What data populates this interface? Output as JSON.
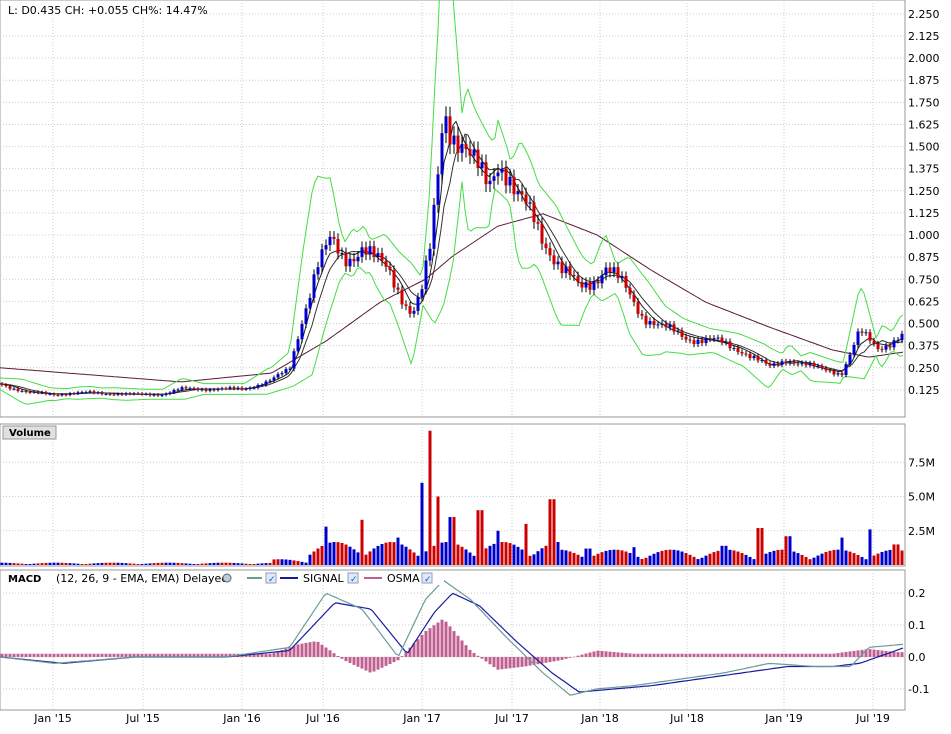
{
  "quote": {
    "text": "L: D0.435 CH: +0.055 CH%: 14.47%"
  },
  "volume_panel": {
    "label": "Volume",
    "ticks": [
      "7.5M",
      "5.0M",
      "2.5M"
    ]
  },
  "macd_panel": {
    "label": "MACD",
    "params": "(12, 26, 9 - EMA, EMA) Delayed",
    "signal_label": "SIGNAL",
    "osma_label": "OSMA",
    "ticks": [
      "0.2",
      "0.1",
      "0.0",
      "-0.1"
    ]
  },
  "x_axis": {
    "labels": [
      "Jan '15",
      "Jul '15",
      "Jan '16",
      "Jul '16",
      "Jan '17",
      "Jul '17",
      "Jan '18",
      "Jul '18",
      "Jan '19",
      "Jul '19"
    ]
  },
  "colors": {
    "up": "#0000cc",
    "down": "#cc0000",
    "bollinger": "#44dd44",
    "ma_long": "#5a1a3a",
    "macd_line": "#6a9a9a",
    "signal_line": "#1a1aa0",
    "osma": "#c06090",
    "grid": "#cccccc"
  },
  "chart_data": [
    {
      "type": "line",
      "series_label": "Price (candlestick with Bollinger Bands and moving averages)",
      "x_labels": [
        "Jan '15",
        "Jul '15",
        "Jan '16",
        "Jul '16",
        "Jan '17",
        "Jul '17",
        "Jan '18",
        "Jul '18",
        "Jan '19",
        "Jul '19"
      ],
      "y_ticks": [
        "2.250",
        "2.125",
        "2.000",
        "1.875",
        "1.750",
        "1.625",
        "1.500",
        "1.375",
        "1.250",
        "1.125",
        "1.000",
        "0.875",
        "0.750",
        "0.625",
        "0.500",
        "0.375",
        "0.250",
        "0.125"
      ],
      "ylim": [
        0,
        2.3
      ],
      "price_points": [
        [
          0,
          0.16
        ],
        [
          0.03,
          0.11
        ],
        [
          0.06,
          0.1
        ],
        [
          0.1,
          0.11
        ],
        [
          0.14,
          0.1
        ],
        [
          0.18,
          0.1
        ],
        [
          0.2,
          0.13
        ],
        [
          0.24,
          0.13
        ],
        [
          0.27,
          0.13
        ],
        [
          0.3,
          0.18
        ],
        [
          0.32,
          0.24
        ],
        [
          0.335,
          0.55
        ],
        [
          0.35,
          0.82
        ],
        [
          0.365,
          0.95
        ],
        [
          0.38,
          0.87
        ],
        [
          0.4,
          0.93
        ],
        [
          0.415,
          0.85
        ],
        [
          0.43,
          0.8
        ],
        [
          0.44,
          0.7
        ],
        [
          0.455,
          0.55
        ],
        [
          0.465,
          0.65
        ],
        [
          0.475,
          0.9
        ],
        [
          0.485,
          1.4
        ],
        [
          0.49,
          1.75
        ],
        [
          0.5,
          1.6
        ],
        [
          0.51,
          1.5
        ],
        [
          0.52,
          1.4
        ],
        [
          0.53,
          1.35
        ],
        [
          0.54,
          1.3
        ],
        [
          0.55,
          1.45
        ],
        [
          0.56,
          1.35
        ],
        [
          0.57,
          1.2
        ],
        [
          0.58,
          1.15
        ],
        [
          0.59,
          1.1
        ],
        [
          0.6,
          1.0
        ],
        [
          0.62,
          0.8
        ],
        [
          0.64,
          0.7
        ],
        [
          0.655,
          0.75
        ],
        [
          0.67,
          0.82
        ],
        [
          0.69,
          0.7
        ],
        [
          0.71,
          0.55
        ],
        [
          0.73,
          0.48
        ],
        [
          0.76,
          0.42
        ],
        [
          0.79,
          0.4
        ],
        [
          0.82,
          0.35
        ],
        [
          0.85,
          0.25
        ],
        [
          0.87,
          0.3
        ],
        [
          0.9,
          0.25
        ],
        [
          0.93,
          0.22
        ],
        [
          0.95,
          0.45
        ],
        [
          0.97,
          0.36
        ],
        [
          1.0,
          0.44
        ]
      ],
      "long_ma_points": [
        [
          0,
          0.25
        ],
        [
          0.1,
          0.21
        ],
        [
          0.2,
          0.17
        ],
        [
          0.3,
          0.22
        ],
        [
          0.36,
          0.4
        ],
        [
          0.42,
          0.62
        ],
        [
          0.47,
          0.75
        ],
        [
          0.5,
          0.88
        ],
        [
          0.55,
          1.05
        ],
        [
          0.6,
          1.12
        ],
        [
          0.66,
          1.0
        ],
        [
          0.72,
          0.8
        ],
        [
          0.78,
          0.62
        ],
        [
          0.85,
          0.48
        ],
        [
          0.92,
          0.35
        ],
        [
          0.96,
          0.31
        ],
        [
          1.0,
          0.34
        ]
      ]
    },
    {
      "type": "bar",
      "series_label": "Volume",
      "y_ticks": [
        "7.5M",
        "5.0M",
        "2.5M"
      ],
      "ylim": [
        0,
        10
      ],
      "peaks": [
        [
          0.36,
          2.8
        ],
        [
          0.4,
          3.3
        ],
        [
          0.44,
          2.0
        ],
        [
          0.465,
          6.0
        ],
        [
          0.475,
          9.8
        ],
        [
          0.485,
          5.0
        ],
        [
          0.5,
          3.5
        ],
        [
          0.53,
          4.0
        ],
        [
          0.55,
          2.5
        ],
        [
          0.58,
          3.0
        ],
        [
          0.61,
          4.8
        ],
        [
          0.65,
          1.2
        ],
        [
          0.7,
          1.3
        ],
        [
          0.8,
          1.4
        ],
        [
          0.84,
          2.7
        ],
        [
          0.87,
          2.1
        ],
        [
          0.93,
          2.0
        ],
        [
          0.96,
          2.6
        ],
        [
          0.99,
          1.5
        ]
      ]
    },
    {
      "type": "line",
      "series_label": "MACD (12, 26, 9 - EMA, EMA)",
      "y_ticks": [
        "0.2",
        "0.1",
        "0.0",
        "-0.1"
      ],
      "ylim": [
        -0.16,
        0.26
      ],
      "series": [
        {
          "name": "MACD",
          "points": [
            [
              0,
              0
            ],
            [
              0.06,
              -0.02
            ],
            [
              0.15,
              0
            ],
            [
              0.25,
              0
            ],
            [
              0.32,
              0.03
            ],
            [
              0.36,
              0.2
            ],
            [
              0.4,
              0.15
            ],
            [
              0.44,
              0.0
            ],
            [
              0.47,
              0.18
            ],
            [
              0.49,
              0.24
            ],
            [
              0.52,
              0.18
            ],
            [
              0.56,
              0.06
            ],
            [
              0.6,
              -0.05
            ],
            [
              0.63,
              -0.12
            ],
            [
              0.66,
              -0.1
            ],
            [
              0.7,
              -0.09
            ],
            [
              0.75,
              -0.07
            ],
            [
              0.8,
              -0.05
            ],
            [
              0.85,
              -0.02
            ],
            [
              0.9,
              -0.03
            ],
            [
              0.94,
              -0.03
            ],
            [
              0.96,
              0.03
            ],
            [
              1.0,
              0.04
            ]
          ]
        },
        {
          "name": "SIGNAL",
          "points": [
            [
              0,
              0
            ],
            [
              0.07,
              -0.02
            ],
            [
              0.15,
              0
            ],
            [
              0.25,
              0
            ],
            [
              0.32,
              0.02
            ],
            [
              0.37,
              0.17
            ],
            [
              0.41,
              0.15
            ],
            [
              0.45,
              0.01
            ],
            [
              0.48,
              0.14
            ],
            [
              0.5,
              0.2
            ],
            [
              0.53,
              0.16
            ],
            [
              0.57,
              0.05
            ],
            [
              0.61,
              -0.05
            ],
            [
              0.64,
              -0.11
            ],
            [
              0.68,
              -0.1
            ],
            [
              0.72,
              -0.09
            ],
            [
              0.77,
              -0.07
            ],
            [
              0.82,
              -0.05
            ],
            [
              0.87,
              -0.03
            ],
            [
              0.92,
              -0.03
            ],
            [
              0.95,
              -0.02
            ],
            [
              1.0,
              0.03
            ]
          ]
        },
        {
          "name": "OSMA",
          "bars": [
            [
              0.3,
              0.01
            ],
            [
              0.33,
              0.04
            ],
            [
              0.35,
              0.05
            ],
            [
              0.38,
              -0.01
            ],
            [
              0.41,
              -0.05
            ],
            [
              0.44,
              -0.01
            ],
            [
              0.47,
              0.08
            ],
            [
              0.49,
              0.12
            ],
            [
              0.52,
              0.02
            ],
            [
              0.55,
              -0.04
            ],
            [
              0.58,
              -0.03
            ],
            [
              0.62,
              -0.01
            ],
            [
              0.66,
              0.02
            ],
            [
              0.7,
              0.01
            ],
            [
              0.75,
              0.01
            ],
            [
              0.8,
              0.01
            ],
            [
              0.85,
              0.01
            ],
            [
              0.92,
              0.01
            ],
            [
              0.96,
              0.025
            ],
            [
              0.99,
              0.015
            ]
          ]
        }
      ]
    }
  ]
}
